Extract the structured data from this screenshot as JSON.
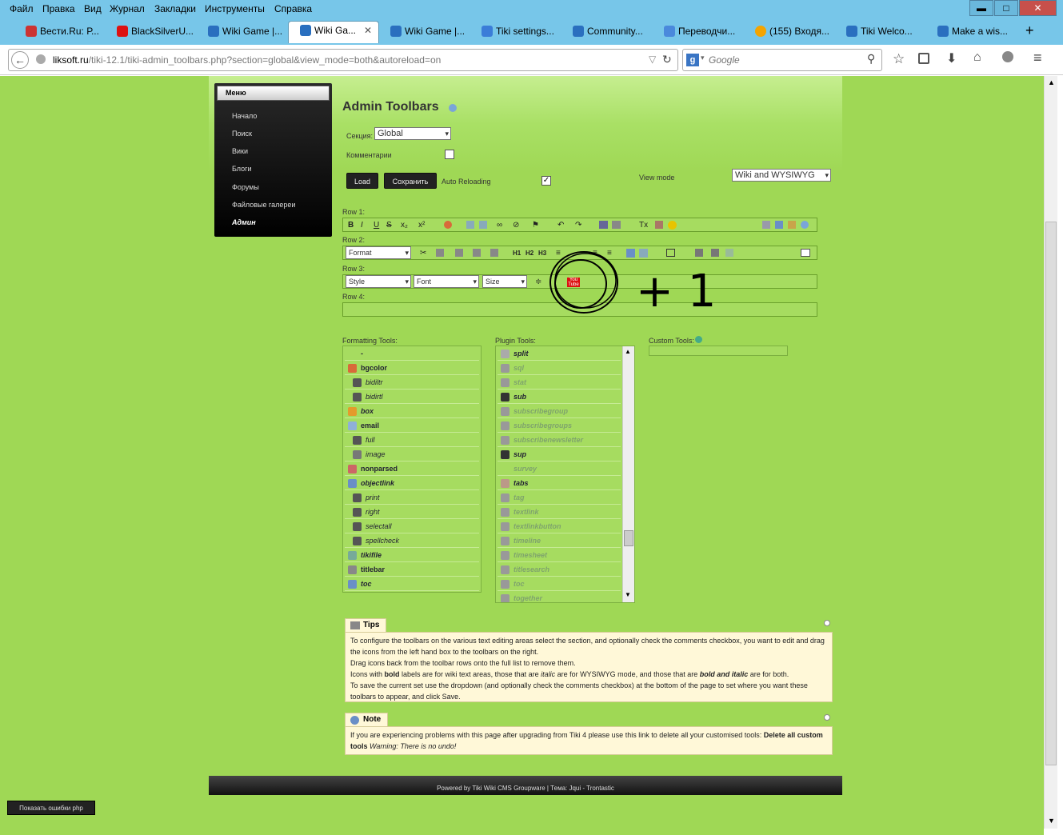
{
  "menubar": {
    "items": [
      "Файл",
      "Правка",
      "Вид",
      "Журнал",
      "Закладки",
      "Инструменты",
      "Справка"
    ]
  },
  "window": {
    "minimize": "▬",
    "maximize": "□",
    "close": "✕"
  },
  "tabs": [
    {
      "label": "Вести.Ru: Р...",
      "color": "#c33"
    },
    {
      "label": "BlackSilverU...",
      "color": "#d11"
    },
    {
      "label": "Wiki Game |...",
      "color": "#2a6fbf"
    },
    {
      "label": "Wiki Ga...",
      "color": "#2a6fbf",
      "active": true
    },
    {
      "label": "Wiki Game |...",
      "color": "#2a6fbf"
    },
    {
      "label": "Tiki settings...",
      "color": "#3b7dd8"
    },
    {
      "label": "Community...",
      "color": "#2a6fbf"
    },
    {
      "label": "Переводчи...",
      "color": "#4a89dc"
    },
    {
      "label": "(155) Входя...",
      "color": "#f4a400"
    },
    {
      "label": "Tiki Welco...",
      "color": "#2a6fbf"
    },
    {
      "label": "Make a wis...",
      "color": "#2a6fbf"
    }
  ],
  "tab_close": "✕",
  "new_tab": "+",
  "url": {
    "host": "liksoft.ru",
    "path": "/tiki-12.1/tiki-admin_toolbars.php?section=global&view_mode=both&autoreload=on"
  },
  "search": {
    "placeholder": "Google"
  },
  "leftmenu": {
    "title": "Меню",
    "items": [
      "Начало",
      "Поиск",
      "Вики",
      "Блоги",
      "Форумы",
      "Файловые галереи",
      "Админ"
    ]
  },
  "admin": {
    "title": "Admin Toolbars",
    "section_label": "Секция:",
    "section_value": "Global",
    "comments_label": "Комментарии",
    "load": "Load",
    "save": "Сохранить",
    "auto_reloading": "Auto Reloading",
    "view_mode_label": "View mode",
    "view_mode_value": "Wiki and WYSIWYG",
    "row1": "Row 1:",
    "row2": "Row 2:",
    "row3": "Row 3:",
    "row4": "Row 4:",
    "format": "Format",
    "style": "Style",
    "font": "Font",
    "size": "Size",
    "formatting_tools": "Formatting Tools:",
    "plugin_tools": "Plugin Tools:",
    "custom_tools": "Custom Tools:"
  },
  "formatting": [
    {
      "t": "-",
      "c": "",
      "s": "bold"
    },
    {
      "t": "bgcolor",
      "c": "#d86a3a",
      "s": "bold"
    },
    {
      "t": "bidiltr",
      "c": "#555",
      "s": "it"
    },
    {
      "t": "bidirtl",
      "c": "#555",
      "s": "it"
    },
    {
      "t": "box",
      "c": "#e39b2c",
      "s": "bi"
    },
    {
      "t": "email",
      "c": "#8fb0d8",
      "s": "bold"
    },
    {
      "t": "full",
      "c": "#555",
      "s": "it"
    },
    {
      "t": "image",
      "c": "#777",
      "s": "it"
    },
    {
      "t": "nonparsed",
      "c": "#c66",
      "s": "bold"
    },
    {
      "t": "objectlink",
      "c": "#6a8fc7",
      "s": "bi"
    },
    {
      "t": "print",
      "c": "#555",
      "s": "it"
    },
    {
      "t": "right",
      "c": "#555",
      "s": "it"
    },
    {
      "t": "selectall",
      "c": "#555",
      "s": "it"
    },
    {
      "t": "spellcheck",
      "c": "#555",
      "s": "it"
    },
    {
      "t": "tikifile",
      "c": "#7a9",
      "s": "bi"
    },
    {
      "t": "titlebar",
      "c": "#888",
      "s": "bold"
    },
    {
      "t": "toc",
      "c": "#6a8fc7",
      "s": "bi"
    }
  ],
  "plugins": [
    {
      "t": "split",
      "c": "#aaa",
      "s": "bi"
    },
    {
      "t": "sql",
      "c": "#999",
      "s": "dim"
    },
    {
      "t": "stat",
      "c": "#999",
      "s": "dim"
    },
    {
      "t": "sub",
      "c": "#333",
      "s": "bi"
    },
    {
      "t": "subscribegroup",
      "c": "#999",
      "s": "dim"
    },
    {
      "t": "subscribegroups",
      "c": "#999",
      "s": "dim"
    },
    {
      "t": "subscribenewsletter",
      "c": "#999",
      "s": "dim"
    },
    {
      "t": "sup",
      "c": "#333",
      "s": "bi"
    },
    {
      "t": "survey",
      "c": "",
      "s": "dim"
    },
    {
      "t": "tabs",
      "c": "#b98",
      "s": "bi"
    },
    {
      "t": "tag",
      "c": "#999",
      "s": "dim"
    },
    {
      "t": "textlink",
      "c": "#999",
      "s": "dim"
    },
    {
      "t": "textlinkbutton",
      "c": "#999",
      "s": "dim"
    },
    {
      "t": "timeline",
      "c": "#999",
      "s": "dim"
    },
    {
      "t": "timesheet",
      "c": "#999",
      "s": "dim"
    },
    {
      "t": "titlesearch",
      "c": "#999",
      "s": "dim"
    },
    {
      "t": "toc",
      "c": "#999",
      "s": "dim"
    },
    {
      "t": "together",
      "c": "#999",
      "s": "dim"
    }
  ],
  "tips": {
    "title": "Tips",
    "l1": "To configure the toolbars on the various text editing areas select the section, and optionally check the comments checkbox, you want to edit and drag the icons from the left hand box to the toolbars on the right.",
    "l2": "Drag icons back from the toolbar rows onto the full list to remove them.",
    "l3a": "Icons with ",
    "l3b": "bold",
    "l3c": " labels are for wiki text areas, those that are ",
    "l3d": "italic",
    "l3e": " are for WYSIWYG mode, and those that are ",
    "l3f": "bold and italic",
    "l3g": " are for both.",
    "l4": "To save the current set use the dropdown (and optionally check the comments checkbox) at the bottom of the page to set where you want these toolbars to appear, and click Save."
  },
  "note": {
    "title": "Note",
    "a": "If you are experiencing problems with this page after upgrading from Tiki 4 please use this link to delete all your customised tools: ",
    "b": "Delete all custom tools",
    "c": " Warning: There is no undo!"
  },
  "footer": {
    "text": "Powered by Tiki Wiki CMS Groupware | Тема: Jqui - Trontastic"
  },
  "php_errors": "Показать ошибки php",
  "annotation": {
    "text": "+ 1"
  },
  "icons": {
    "back": "back-arrow-icon",
    "reload": "reload-icon",
    "star": "bookmark-star-icon",
    "home": "home-icon",
    "download": "download-icon",
    "menu": "hamburger-menu-icon"
  }
}
